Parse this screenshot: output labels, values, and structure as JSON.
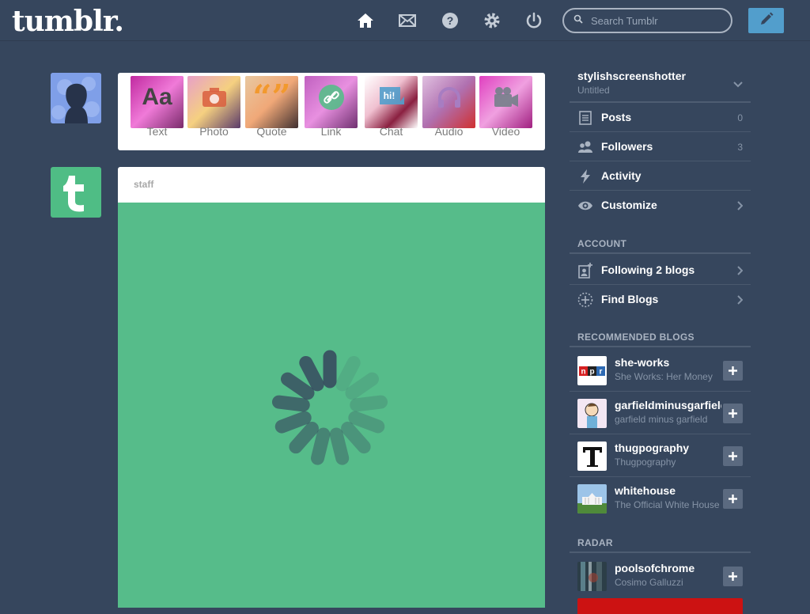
{
  "header": {
    "logo": "tumblr.",
    "search": {
      "placeholder": "Search Tumblr",
      "value": ""
    },
    "nav_icons": [
      "home-icon",
      "mail-icon",
      "help-icon",
      "gear-icon",
      "power-icon"
    ],
    "compose_icon": "pencil-icon"
  },
  "post_types": [
    {
      "label": "Text",
      "glyph": "Aa",
      "color": "#444444"
    },
    {
      "label": "Photo",
      "glyph": "photo",
      "color": "#d95e40"
    },
    {
      "label": "Quote",
      "glyph": "“”",
      "color": "#f2992e"
    },
    {
      "label": "Link",
      "glyph": "link",
      "color": "#56bc8a"
    },
    {
      "label": "Chat",
      "glyph": "hi!",
      "color": "#529ecc"
    },
    {
      "label": "Audio",
      "glyph": "headphones",
      "color": "#a77dc2"
    },
    {
      "label": "Video",
      "glyph": "video",
      "color": "#748089"
    }
  ],
  "post": {
    "author": "staff"
  },
  "sidebar": {
    "blog": {
      "name": "stylishscreenshotter",
      "title": "Untitled"
    },
    "items": [
      {
        "label": "Posts",
        "count": "0",
        "icon": "posts-icon"
      },
      {
        "label": "Followers",
        "count": "3",
        "icon": "followers-icon"
      },
      {
        "label": "Activity",
        "count": "",
        "icon": "activity-icon"
      },
      {
        "label": "Customize",
        "count": "",
        "icon": "eye-icon"
      }
    ],
    "account_heading": "ACCOUNT",
    "account_items": [
      {
        "label": "Following 2 blogs",
        "icon": "following-icon"
      },
      {
        "label": "Find Blogs",
        "icon": "find-blogs-icon"
      }
    ],
    "recommended_heading": "RECOMMENDED BLOGS",
    "recommended": [
      {
        "name": "she-works",
        "desc": "She Works: Her Money"
      },
      {
        "name": "garfieldminusgarfield",
        "desc": "garfield minus garfield"
      },
      {
        "name": "thugpography",
        "desc": "Thugpography"
      },
      {
        "name": "whitehouse",
        "desc": "The Official White House"
      }
    ],
    "radar_heading": "RADAR",
    "radar": {
      "name": "poolsofchrome",
      "desc": "Cosimo Galluzzi"
    }
  },
  "colors": {
    "background": "#36465d",
    "accent": "#529ecc",
    "post_media": "#56bc8a"
  }
}
